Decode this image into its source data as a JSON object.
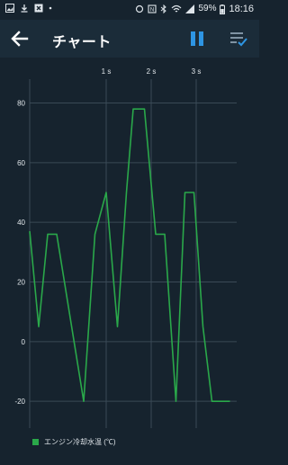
{
  "status_bar": {
    "battery": "59%",
    "time": "18:16",
    "icons": [
      "image-icon",
      "download-icon",
      "close-box-icon",
      "dot-icon",
      "sync-icon",
      "nfc-icon",
      "bluetooth-icon",
      "wifi-icon",
      "signal-icon",
      "battery-icon"
    ]
  },
  "app_bar": {
    "title": "チャート",
    "back_icon": "back-arrow-icon",
    "pause_icon": "pause-icon",
    "list_icon": "checklist-icon"
  },
  "colors": {
    "background": "#16232e",
    "app_bar": "#1b2c39",
    "accent": "#2e95e3",
    "series": "#2aa84a",
    "grid": "#3a4a56"
  },
  "chart_data": {
    "type": "line",
    "xlabel": "",
    "ylabel": "",
    "x_ticks": [
      "1 s",
      "2 s",
      "3 s"
    ],
    "x_tick_values": [
      1,
      2,
      3
    ],
    "xlim": [
      -0.7,
      3.9
    ],
    "y_ticks": [
      "80",
      "60",
      "40",
      "20",
      "0",
      "-20"
    ],
    "y_tick_values": [
      80,
      60,
      40,
      20,
      0,
      -20
    ],
    "ylim": [
      -29,
      88
    ],
    "grid": true,
    "legend_position": "bottom-left",
    "series": [
      {
        "name": "エンジン冷却水温 (℃)",
        "color": "#2aa84a",
        "x": [
          -0.7,
          -0.5,
          -0.3,
          -0.1,
          0.2,
          0.5,
          0.75,
          1.0,
          1.25,
          1.45,
          1.6,
          1.85,
          2.1,
          2.3,
          2.55,
          2.75,
          2.95,
          3.15,
          3.35,
          3.55,
          3.75
        ],
        "y": [
          37,
          5,
          36,
          36,
          8,
          -20,
          36,
          50,
          5,
          50,
          78,
          78,
          36,
          36,
          -20,
          50,
          50,
          5,
          -20,
          -20,
          -20
        ]
      }
    ]
  }
}
